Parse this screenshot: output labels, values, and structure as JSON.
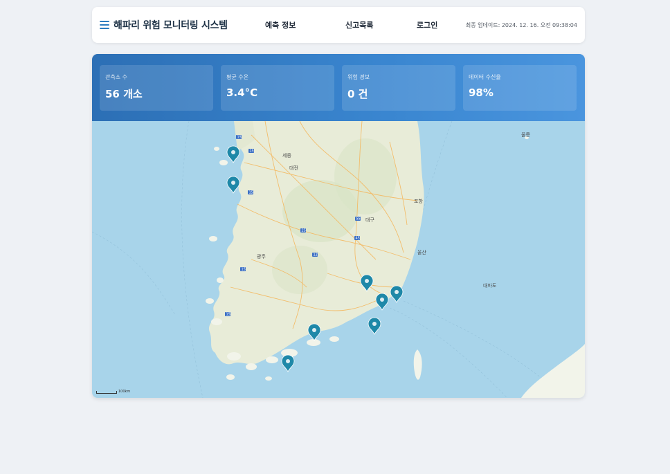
{
  "header": {
    "title": "해파리 위험 모니터링 시스템",
    "nav": [
      "예측 정보",
      "신고목록",
      "로그인"
    ],
    "updated": "최종 업데이트: 2024. 12. 16. 오전 09:38:04"
  },
  "stats": [
    {
      "label": "관측소 수",
      "value": "56 개소"
    },
    {
      "label": "평균 수온",
      "value": "3.4°C"
    },
    {
      "label": "위험 경보",
      "value": "0 건"
    },
    {
      "label": "데이터 수신율",
      "value": "98%"
    }
  ],
  "map": {
    "scale_label": "100km",
    "marker_icon": "location-pin-icon",
    "colors": {
      "sea": "#a8d4ea",
      "land": "#e8ecd8",
      "marker": "#1e88a8",
      "accent": "#2c6fb5"
    }
  }
}
